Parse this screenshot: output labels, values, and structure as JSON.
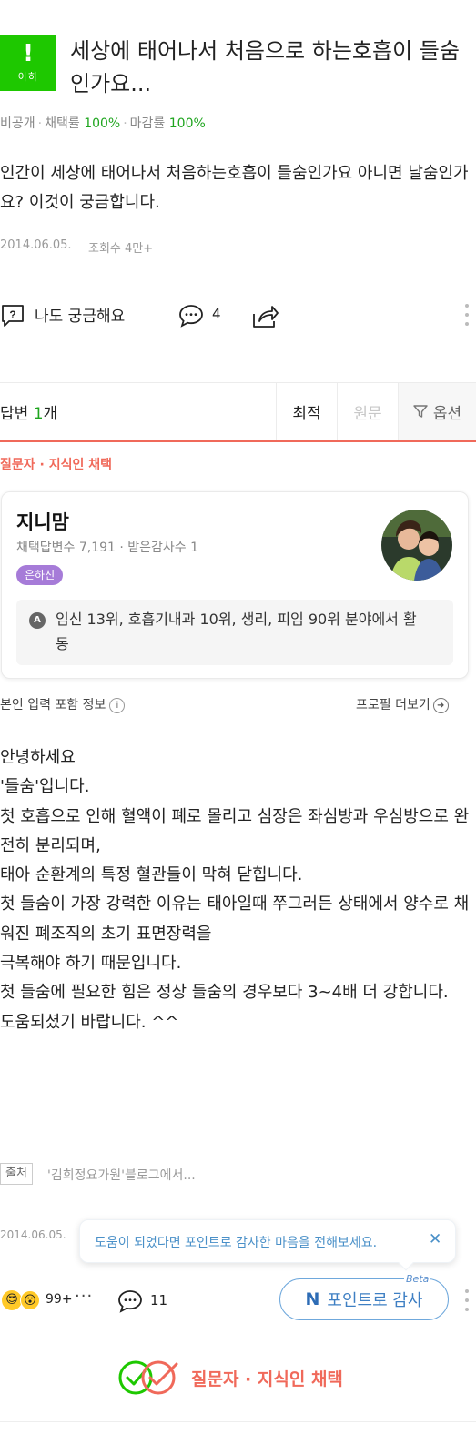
{
  "question": {
    "badge_symbol": "!",
    "badge_label": "아하",
    "title": "세상에 태어나서 처음으로 하는호흡이 들숨인가요...",
    "meta": {
      "privacy": "비공개",
      "adoption_label": "채택률",
      "adoption_value": "100%",
      "close_label": "마감률",
      "close_value": "100%"
    },
    "body": "인간이 세상에 태어나서 처음하는호흡이 들숨인가요 아니면 날숨인가요? 이것이 궁금합니다.",
    "date": "2014.06.05.",
    "views": "조회수 4만+",
    "actions": {
      "curious_label": "나도 궁금해요",
      "comment_count": "4"
    }
  },
  "answers_bar": {
    "label_prefix": "답변",
    "count": "1",
    "label_suffix": "개",
    "sort_latest": "최적",
    "sort_original": "원문",
    "options": "옵션"
  },
  "answer": {
    "pick_label": "질문자 · 지식인 채택",
    "profile": {
      "name": "지니맘",
      "stats": "채택답변수 7,191 · 받은감사수 1",
      "rank": "은하신",
      "activity_icon": "A",
      "activity": "임신 13위, 호흡기내과 10위, 생리, 피임 90위 분야에서 활동"
    },
    "info_included": "본인 입력 포함 정보",
    "profile_more": "프로필 더보기",
    "body_lines": [
      "안녕하세요",
      "'들숨'입니다.",
      "첫 호흡으로 인해 혈액이 폐로 몰리고 심장은 좌심방과 우심방으로 완전히 분리되며,",
      "태아 순환계의 특정 혈관들이 막혀 닫힙니다.",
      "첫 들숨이 가장 강력한 이유는 태아일때 쭈그러든 상태에서 양수로 채워진 폐조직의 초기 표면장력을",
      "극복해야 하기 때문입니다.",
      "첫 들숨에 필요한 힘은 정상 들숨의 경우보다 3~4배 더 강합니다.",
      "도움되셨기 바랍니다. ^^"
    ],
    "source_tag": "출처",
    "source_text": "'김희정요가원'블로그에서...",
    "date": "2014.06.05.",
    "tooltip": "도움이 되었다면 포인트로 감사한 마음을 전해보세요.",
    "reactions": {
      "emoji1": "😍",
      "emoji2": "😮",
      "count": "99+",
      "more": "···",
      "comment_count": "11"
    },
    "point_button": {
      "prefix": "N",
      "label": "포인트로 감사",
      "beta": "Beta"
    },
    "footer_pick": "질문자 · 지식인 채택"
  },
  "colors": {
    "brand_green": "#1ec800",
    "pick_red": "#f0695a",
    "point_blue": "#3e7fc3",
    "rank_purple": "#a67bd8"
  }
}
